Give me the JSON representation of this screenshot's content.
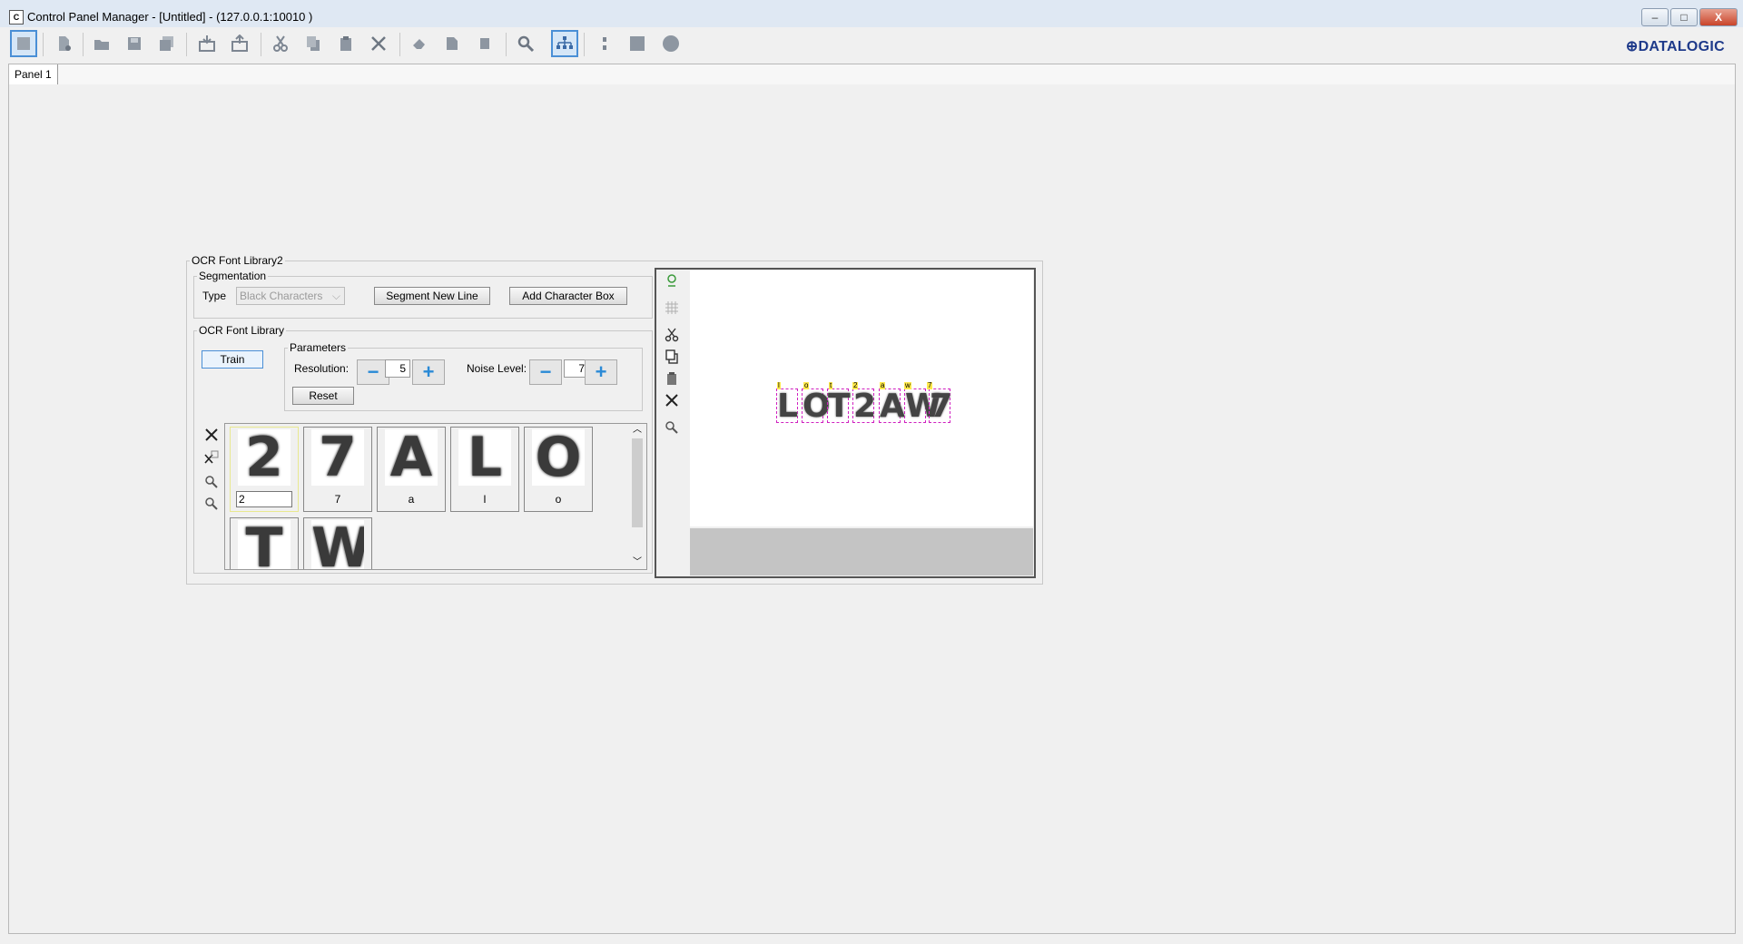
{
  "window": {
    "title": "Control Panel Manager - [Untitled] - (127.0.0.1:10010 )",
    "app_icon": "C",
    "minimize": "–",
    "maximize": "□",
    "close": "X"
  },
  "toolbar": {
    "logo": "⊕DATALOGIC",
    "icons": [
      "panel-view-icon",
      "new-document-icon",
      "open-folder-icon",
      "save-icon",
      "save-all-icon",
      "import-icon",
      "export-icon",
      "cut-icon",
      "copy-icon",
      "paste-icon",
      "delete-icon",
      "eraser-icon",
      "page-icon",
      "stop-icon",
      "search-icon",
      "hierarchy-icon",
      "vertical-dots-icon",
      "square-icon",
      "circle-icon"
    ]
  },
  "tabs": [
    {
      "label": "Panel 1",
      "selected": true
    }
  ],
  "ocr_widget": {
    "title": "OCR Font Library2",
    "segmentation": {
      "legend": "Segmentation",
      "type_label": "Type",
      "type_value": "Black Characters",
      "segment_button": "Segment New Line",
      "add_box_button": "Add Character Box"
    },
    "library": {
      "legend": "OCR Font Library",
      "train_button": "Train",
      "parameters": {
        "legend": "Parameters",
        "resolution_label": "Resolution:",
        "resolution_value": "5",
        "noise_label": "Noise Level:",
        "noise_value": "7",
        "minus": "−",
        "plus": "+",
        "reset_button": "Reset"
      },
      "glyphs": [
        {
          "char": "2",
          "label": "2",
          "editing": true
        },
        {
          "char": "7",
          "label": "7"
        },
        {
          "char": "A",
          "label": "a"
        },
        {
          "char": "L",
          "label": "l"
        },
        {
          "char": "O",
          "label": "o"
        },
        {
          "char": "T",
          "label": ""
        },
        {
          "char": "W",
          "label": ""
        }
      ]
    },
    "image": {
      "ocr_chars": [
        "L",
        "O",
        "T",
        "2",
        "A",
        "W",
        "7"
      ],
      "ocr_indices": [
        "l",
        "o",
        "t",
        "2",
        "a",
        "w",
        "7"
      ]
    }
  },
  "colors": {
    "selection_border": "#d020c0",
    "active_tool_border": "#4a8fd6",
    "plus_color": "#2a8ad6",
    "editing_cell_border": "#e8e890"
  }
}
